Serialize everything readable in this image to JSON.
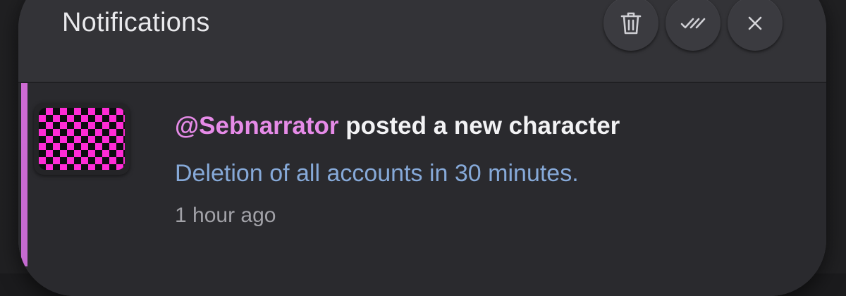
{
  "panel": {
    "title": "Notifications"
  },
  "actions": [
    {
      "name": "trash-icon",
      "label": "Delete"
    },
    {
      "name": "double-check-icon",
      "label": "Mark all read"
    },
    {
      "name": "close-icon",
      "label": "Close"
    }
  ],
  "notification": {
    "mention": "@Sebnarrator",
    "text": " posted a new character",
    "message": "Deletion of all accounts in 30 minutes.",
    "time": "1 hour ago",
    "accent_color": "#cf6bd4",
    "mention_color": "#e68be8",
    "message_color": "#86a9d8",
    "avatar": {
      "pattern": "checkerboard",
      "colors": [
        "#ff2bd6",
        "#0d0d10"
      ]
    }
  }
}
